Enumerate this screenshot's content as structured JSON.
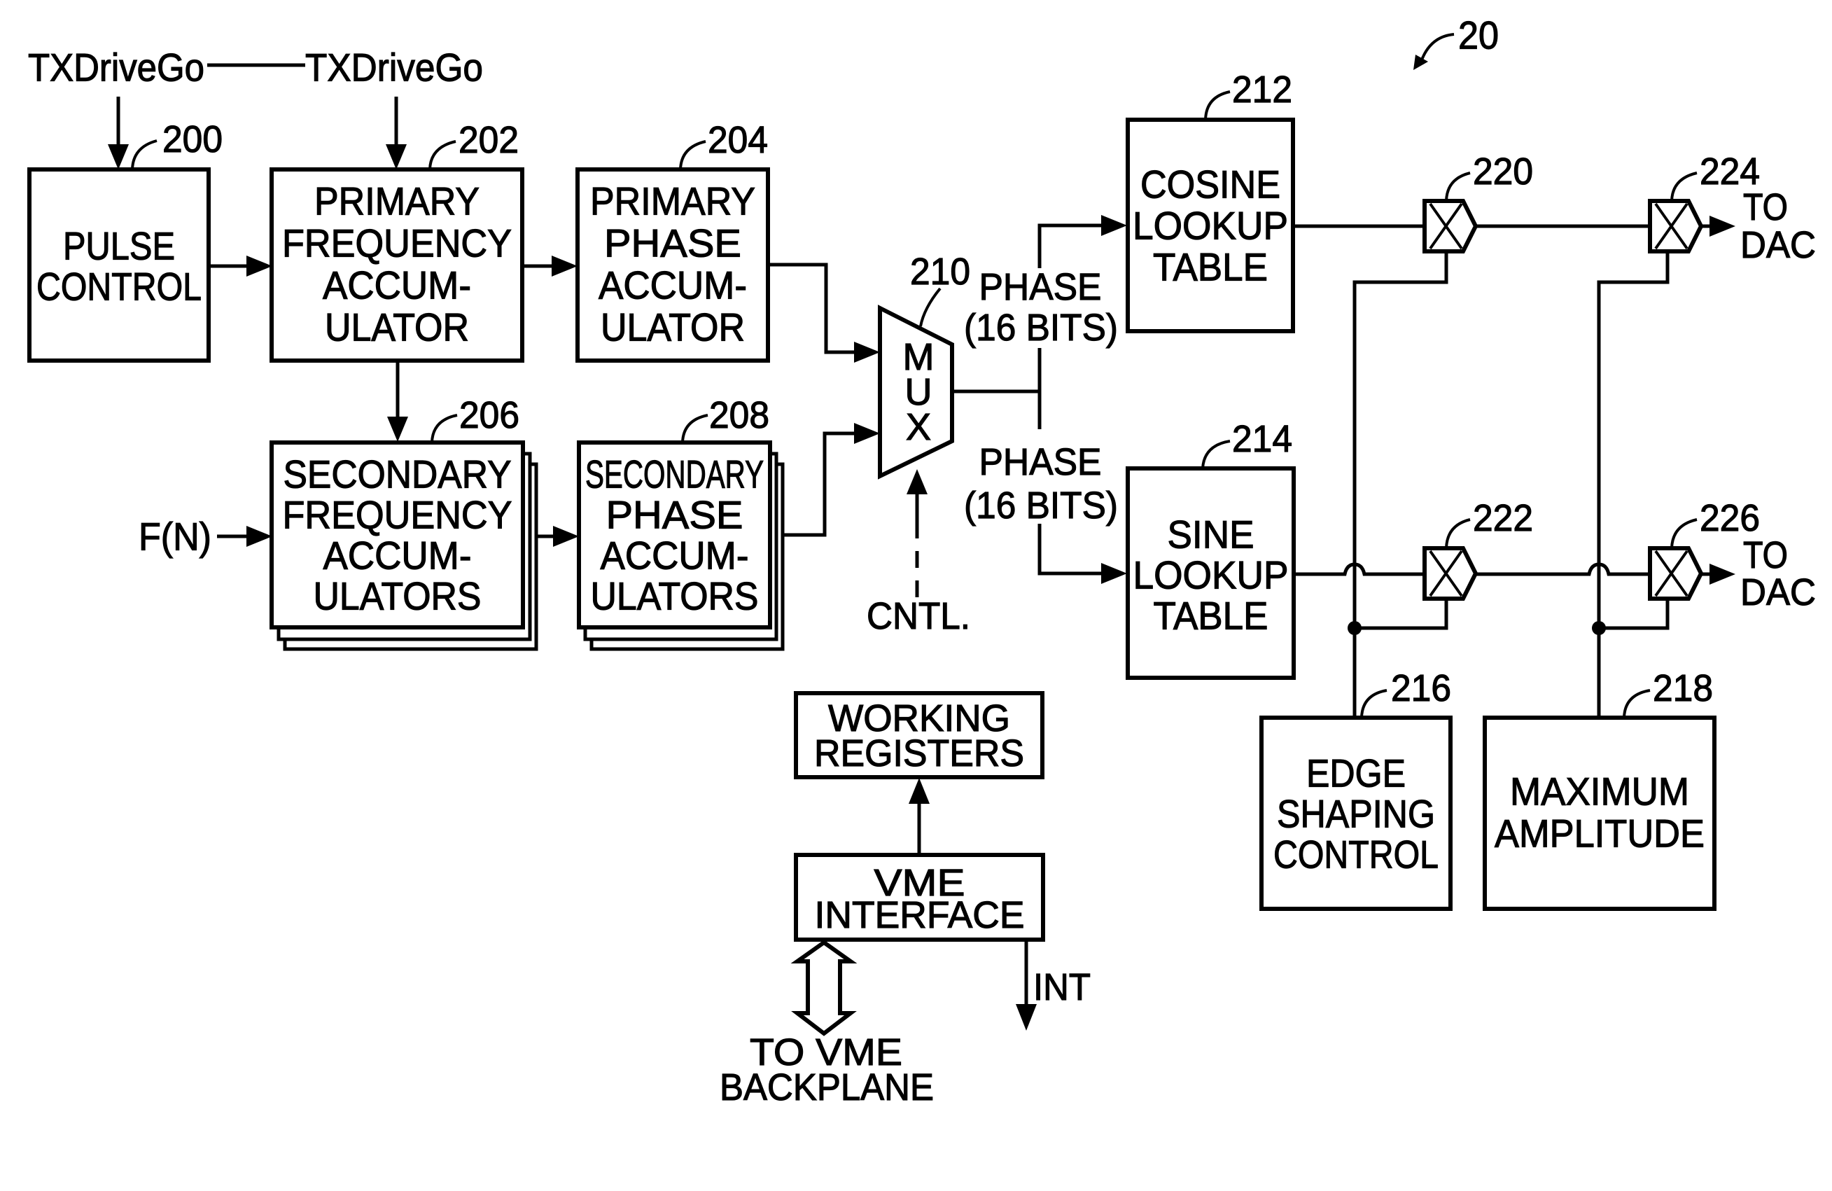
{
  "figure": {
    "reference_label": "20",
    "colors": {
      "ink": "#000000",
      "paper": "#ffffff"
    }
  },
  "inputs": {
    "txdrivego_left": "TXDriveGo",
    "txdrivego_right": "TXDriveGo",
    "fn": "F(N)",
    "cntl": "CNTL."
  },
  "blocks": {
    "pulse_control": {
      "ref": "200",
      "lines": [
        "PULSE",
        "CONTROL"
      ]
    },
    "primary_frequency_accumulator": {
      "ref": "202",
      "lines": [
        "PRIMARY",
        "FREQUENCY",
        "ACCUM-",
        "ULATOR"
      ]
    },
    "primary_phase_accumulator": {
      "ref": "204",
      "lines": [
        "PRIMARY",
        "PHASE",
        "ACCUM-",
        "ULATOR"
      ]
    },
    "secondary_frequency_accumulators": {
      "ref": "206",
      "lines": [
        "SECONDARY",
        "FREQUENCY",
        "ACCUM-",
        "ULATORS"
      ]
    },
    "secondary_phase_accumulators": {
      "ref": "208",
      "lines": [
        "SECONDARY",
        "PHASE",
        "ACCUM-",
        "ULATORS"
      ]
    },
    "mux": {
      "ref": "210",
      "lines": [
        "M",
        "U",
        "X"
      ]
    },
    "cosine_lookup_table": {
      "ref": "212",
      "lines": [
        "COSINE",
        "LOOKUP",
        "TABLE"
      ]
    },
    "sine_lookup_table": {
      "ref": "214",
      "lines": [
        "SINE",
        "LOOKUP",
        "TABLE"
      ]
    },
    "edge_shaping_control": {
      "ref": "216",
      "lines": [
        "EDGE",
        "SHAPING",
        "CONTROL"
      ]
    },
    "maximum_amplitude": {
      "ref": "218",
      "lines": [
        "MAXIMUM",
        "AMPLITUDE"
      ]
    },
    "working_registers": {
      "lines": [
        "WORKING",
        "REGISTERS"
      ]
    },
    "vme_interface": {
      "lines": [
        "VME",
        "INTERFACE"
      ]
    }
  },
  "multipliers": {
    "m220": {
      "ref": "220"
    },
    "m222": {
      "ref": "222"
    },
    "m224": {
      "ref": "224"
    },
    "m226": {
      "ref": "226"
    }
  },
  "signals": {
    "phase_upper": [
      "PHASE",
      "(16 BITS)"
    ],
    "phase_lower": [
      "PHASE",
      "(16 BITS)"
    ],
    "to_dac_upper": [
      "TO",
      "DAC"
    ],
    "to_dac_lower": [
      "TO",
      "DAC"
    ],
    "int": "INT",
    "to_vme_backplane": [
      "TO VME",
      "BACKPLANE"
    ]
  }
}
